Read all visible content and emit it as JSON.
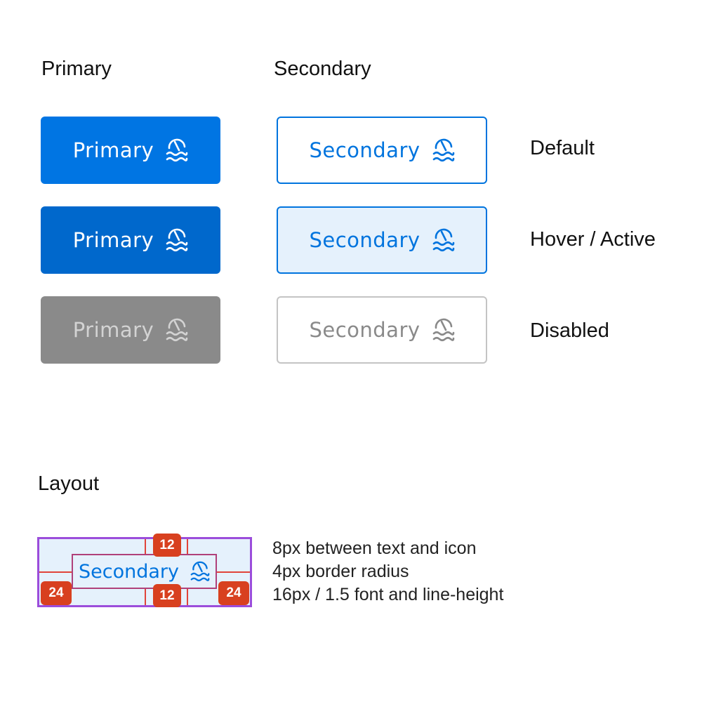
{
  "columns": {
    "primary_heading": "Primary",
    "secondary_heading": "Secondary"
  },
  "states": {
    "default": "Default",
    "hover": "Hover / Active",
    "disabled": "Disabled"
  },
  "buttons": {
    "primary_label": "Primary",
    "secondary_label": "Secondary",
    "icon": "swimming-icon"
  },
  "layout": {
    "heading": "Layout",
    "button_label": "Secondary",
    "padding_top": "12",
    "padding_bottom": "12",
    "padding_left": "24",
    "padding_right": "24",
    "notes": [
      "8px between text and icon",
      "4px border radius",
      "16px / 1.5 font and line-height"
    ]
  },
  "colors": {
    "primary": "#0075e3",
    "primary_disabled": "#8a8a8a",
    "secondary_border": "#0074de",
    "secondary_hover_bg": "#e5f1fc",
    "disabled_border": "#c4c4c4",
    "spacing_badge": "#d8401f",
    "outline": "#9b4ddb"
  }
}
